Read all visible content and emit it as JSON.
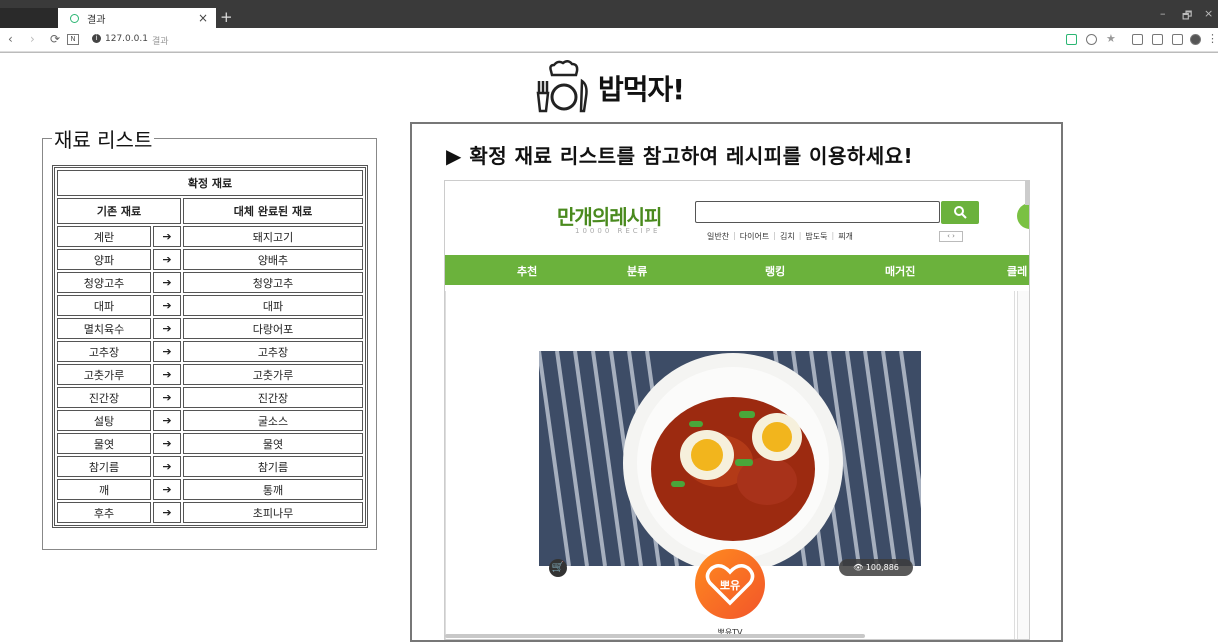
{
  "browser": {
    "tab_title": "결과",
    "tab_close": "×",
    "new_tab": "+",
    "url_host": "127.0.0.1",
    "url_path": "결과",
    "window_controls": [
      "–",
      "🗗",
      "×"
    ],
    "nav_icons": [
      "back-icon",
      "forward-icon",
      "reload-icon"
    ]
  },
  "logo": {
    "text": "밥먹자!"
  },
  "materials": {
    "legend": "재료 리스트",
    "confirmed_header": "확정 재료",
    "col_original": "기존 재료",
    "col_replaced": "대체 완료된 재료",
    "arrow": "➔",
    "rows": [
      {
        "original": "계란",
        "replaced": "돼지고기"
      },
      {
        "original": "양파",
        "replaced": "양배추"
      },
      {
        "original": "청양고추",
        "replaced": "청양고추"
      },
      {
        "original": "대파",
        "replaced": "대파"
      },
      {
        "original": "멸치육수",
        "replaced": "다랑어포"
      },
      {
        "original": "고추장",
        "replaced": "고추장"
      },
      {
        "original": "고춧가루",
        "replaced": "고춧가루"
      },
      {
        "original": "진간장",
        "replaced": "진간장"
      },
      {
        "original": "설탕",
        "replaced": "굴소스"
      },
      {
        "original": "물엿",
        "replaced": "물엿"
      },
      {
        "original": "참기름",
        "replaced": "참기름"
      },
      {
        "original": "깨",
        "replaced": "통깨"
      },
      {
        "original": "후추",
        "replaced": "초피나무"
      }
    ]
  },
  "main": {
    "heading": "▶ 확정 재료 리스트를 참고하여 레시피를 이용하세요!"
  },
  "site": {
    "logo": "만개의레시피",
    "logo_sub": "10000 RECIPE",
    "search_value": "",
    "search_icon": "search-icon",
    "keywords": [
      "일반찬",
      "다이어트",
      "김치",
      "밥도둑",
      "찌개"
    ],
    "keyword_arrows": "‹ ›",
    "nav": [
      "추천",
      "분류",
      "랭킹",
      "매거진",
      "클레"
    ],
    "views": "100,886",
    "badge_text": "뽀유",
    "author": "뽀유TV",
    "accent": "#6bb23c"
  }
}
